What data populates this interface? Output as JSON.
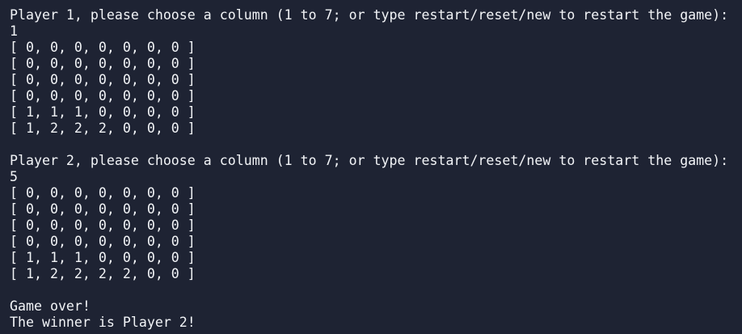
{
  "terminal": {
    "turn1": {
      "prompt": "Player 1, please choose a column (1 to 7; or type restart/reset/new to restart the game):",
      "input": "1",
      "board": [
        "[ 0, 0, 0, 0, 0, 0, 0 ]",
        "[ 0, 0, 0, 0, 0, 0, 0 ]",
        "[ 0, 0, 0, 0, 0, 0, 0 ]",
        "[ 0, 0, 0, 0, 0, 0, 0 ]",
        "[ 1, 1, 1, 0, 0, 0, 0 ]",
        "[ 1, 2, 2, 2, 0, 0, 0 ]"
      ]
    },
    "turn2": {
      "prompt": "Player 2, please choose a column (1 to 7; or type restart/reset/new to restart the game):",
      "input": "5",
      "board": [
        "[ 0, 0, 0, 0, 0, 0, 0 ]",
        "[ 0, 0, 0, 0, 0, 0, 0 ]",
        "[ 0, 0, 0, 0, 0, 0, 0 ]",
        "[ 0, 0, 0, 0, 0, 0, 0 ]",
        "[ 1, 1, 1, 0, 0, 0, 0 ]",
        "[ 1, 2, 2, 2, 2, 0, 0 ]"
      ]
    },
    "result": {
      "game_over": "Game over!",
      "winner": "The winner is Player 2!"
    }
  }
}
